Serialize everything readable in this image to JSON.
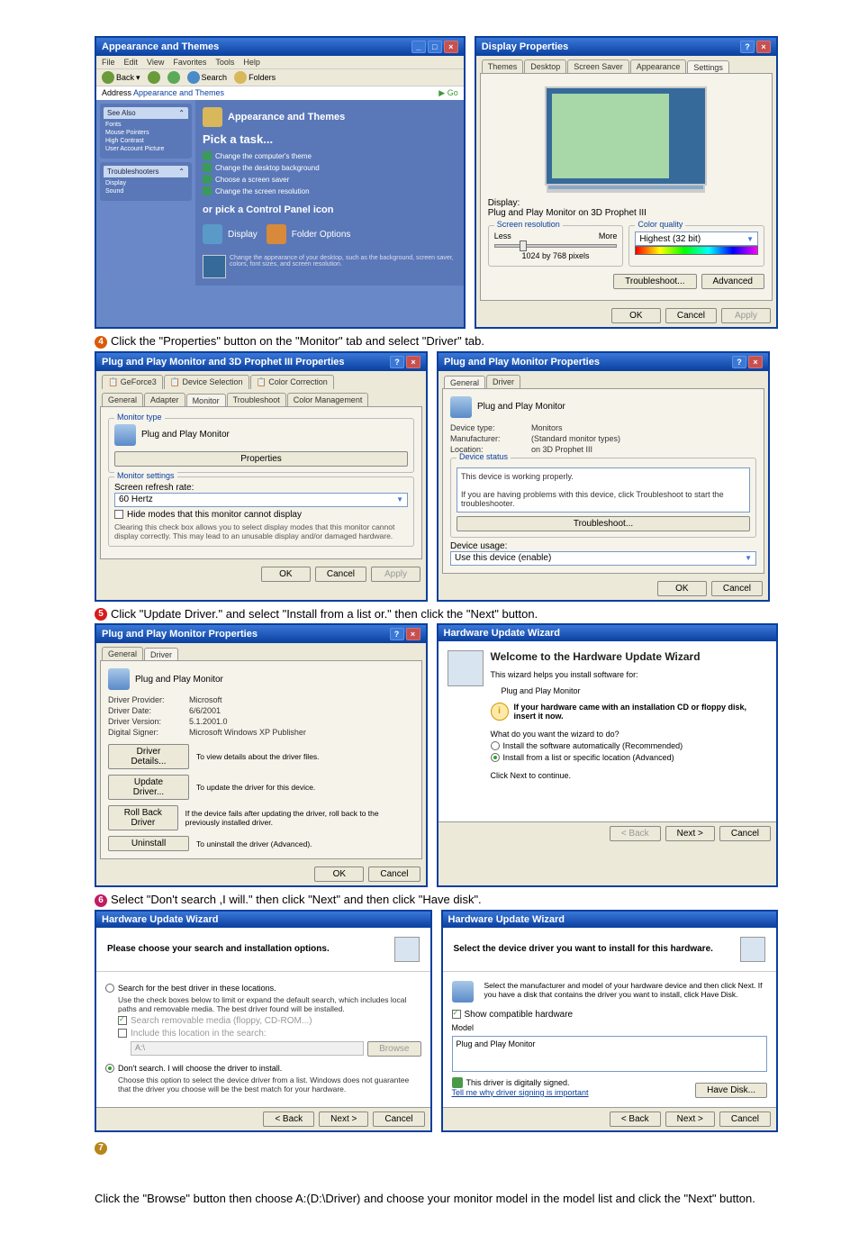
{
  "step3_line": "",
  "step4_line": "Click the \"Properties\" button on the \"Monitor\" tab and select \"Driver\" tab.",
  "step5_line": "Click \"Update Driver.\" and select \"Install from a list or.\" then click the \"Next\" button.",
  "step6_line": "Select \"Don't search ,I will.\" then click \"Next\" and then click \"Have disk\".",
  "bottom_para": "Click the \"Browse\" button then choose A:(D:\\Driver) and choose your monitor model in the model list and click the \"Next\" button.",
  "cp": {
    "title": "Appearance and Themes",
    "menubar": [
      "File",
      "Edit",
      "View",
      "Favorites",
      "Tools",
      "Help"
    ],
    "toolbar_back": "Back",
    "toolbar_search": "Search",
    "toolbar_folders": "Folders",
    "addr_label": "Address",
    "addr_value": "Appearance and Themes",
    "addr_go": "Go",
    "side_seealso": "See Also",
    "side_seealso_items": [
      "Fonts",
      "Mouse Pointers",
      "High Contrast",
      "User Account Picture"
    ],
    "side_trouble": "Troubleshooters",
    "side_trouble_items": [
      "Display",
      "Sound"
    ],
    "heading": "Appearance and Themes",
    "pick": "Pick a task...",
    "links": [
      "Change the computer's theme",
      "Change the desktop background",
      "Choose a screen saver",
      "Change the screen resolution"
    ],
    "orpick": "or pick a Control Panel icon",
    "cats": [
      "Display",
      "Folder Options"
    ],
    "desc": "Change the appearance of your desktop, such as the background, screen saver, colors, font sizes, and screen resolution."
  },
  "dispProps": {
    "title": "Display Properties",
    "tabs": [
      "Themes",
      "Desktop",
      "Screen Saver",
      "Appearance",
      "Settings"
    ],
    "display_label": "Display:",
    "display_value": "Plug and Play Monitor on 3D Prophet III",
    "sr_group": "Screen resolution",
    "less": "Less",
    "more": "More",
    "sr_value": "1024 by 768 pixels",
    "cq_group": "Color quality",
    "cq_value": "Highest (32 bit)",
    "trouble": "Troubleshoot...",
    "adv": "Advanced",
    "ok": "OK",
    "cancel": "Cancel",
    "apply": "Apply"
  },
  "monProps": {
    "title": "Plug and Play Monitor and 3D Prophet III Properties",
    "tabs_top": [
      "GeForce3",
      "Device Selection",
      "Color Correction"
    ],
    "tabs_bot": [
      "General",
      "Adapter",
      "Monitor",
      "Troubleshoot",
      "Color Management"
    ],
    "mt_group": "Monitor type",
    "mt_value": "Plug and Play Monitor",
    "props_btn": "Properties",
    "ms_group": "Monitor settings",
    "refresh_label": "Screen refresh rate:",
    "refresh_value": "60 Hertz",
    "hide_cb": "Hide modes that this monitor cannot display",
    "hide_desc": "Clearing this check box allows you to select display modes that this monitor cannot display correctly. This may lead to an unusable display and/or damaged hardware.",
    "ok": "OK",
    "cancel": "Cancel",
    "apply": "Apply"
  },
  "pnpGeneral": {
    "title": "Plug and Play Monitor Properties",
    "tabs": [
      "General",
      "Driver"
    ],
    "name": "Plug and Play Monitor",
    "dt_l": "Device type:",
    "dt_v": "Monitors",
    "mf_l": "Manufacturer:",
    "mf_v": "(Standard monitor types)",
    "lo_l": "Location:",
    "lo_v": "on 3D Prophet III",
    "status_group": "Device status",
    "status_msg": "This device is working properly.",
    "status_help": "If you are having problems with this device, click Troubleshoot to start the troubleshooter.",
    "trouble": "Troubleshoot...",
    "usage_l": "Device usage:",
    "usage_v": "Use this device (enable)",
    "ok": "OK",
    "cancel": "Cancel"
  },
  "pnpDriver": {
    "title": "Plug and Play Monitor Properties",
    "tabs": [
      "General",
      "Driver"
    ],
    "name": "Plug and Play Monitor",
    "dp_l": "Driver Provider:",
    "dp_v": "Microsoft",
    "dd_l": "Driver Date:",
    "dd_v": "6/6/2001",
    "dv_l": "Driver Version:",
    "dv_v": "5.1.2001.0",
    "ds_l": "Digital Signer:",
    "ds_v": "Microsoft Windows XP Publisher",
    "btn_details": "Driver Details...",
    "btn_details_d": "To view details about the driver files.",
    "btn_update": "Update Driver...",
    "btn_update_d": "To update the driver for this device.",
    "btn_roll": "Roll Back Driver",
    "btn_roll_d": "If the device fails after updating the driver, roll back to the previously installed driver.",
    "btn_unin": "Uninstall",
    "btn_unin_d": "To uninstall the driver (Advanced).",
    "ok": "OK",
    "cancel": "Cancel"
  },
  "wiz1": {
    "title": "Hardware Update Wizard",
    "welcome": "Welcome to the Hardware Update Wizard",
    "help": "This wizard helps you install software for:",
    "device": "Plug and Play Monitor",
    "cd_msg": "If your hardware came with an installation CD or floppy disk, insert it now.",
    "q": "What do you want the wizard to do?",
    "r1": "Install the software automatically (Recommended)",
    "r2": "Install from a list or specific location (Advanced)",
    "cont": "Click Next to continue.",
    "back": "< Back",
    "next": "Next >",
    "cancel": "Cancel"
  },
  "wiz2": {
    "title": "Hardware Update Wizard",
    "heading": "Please choose your search and installation options.",
    "r1": "Search for the best driver in these locations.",
    "r1_desc": "Use the check boxes below to limit or expand the default search, which includes local paths and removable media. The best driver found will be installed.",
    "cb1": "Search removable media (floppy, CD-ROM...)",
    "cb2": "Include this location in the search:",
    "path": "A:\\",
    "browse": "Browse",
    "r2": "Don't search. I will choose the driver to install.",
    "r2_desc": "Choose this option to select the device driver from a list. Windows does not guarantee that the driver you choose will be the best match for your hardware.",
    "back": "< Back",
    "next": "Next >",
    "cancel": "Cancel"
  },
  "wiz3": {
    "title": "Hardware Update Wizard",
    "heading": "Select the device driver you want to install for this hardware.",
    "desc": "Select the manufacturer and model of your hardware device and then click Next. If you have a disk that contains the driver you want to install, click Have Disk.",
    "show_compat": "Show compatible hardware",
    "model_l": "Model",
    "model_v": "Plug and Play Monitor",
    "signed": "This driver is digitally signed.",
    "tell": "Tell me why driver signing is important",
    "have_disk": "Have Disk...",
    "back": "< Back",
    "next": "Next >",
    "cancel": "Cancel"
  }
}
